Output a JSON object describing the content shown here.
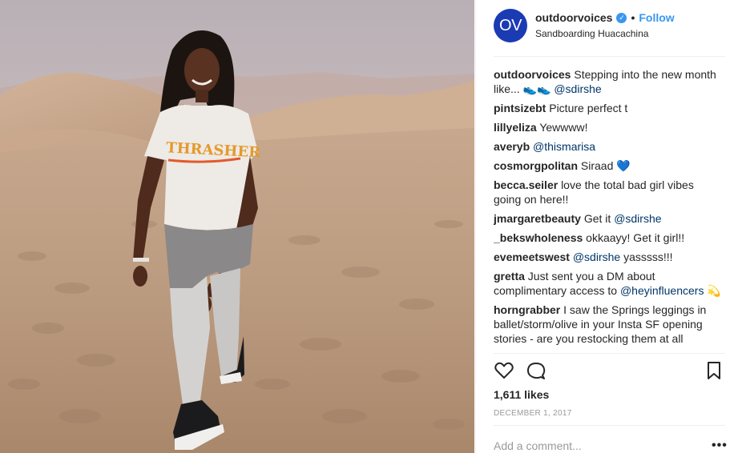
{
  "post": {
    "account": {
      "avatar_text": "OV",
      "username": "outdoorvoices",
      "separator": "•",
      "follow_label": "Follow",
      "location": "Sandboarding Huacachina"
    },
    "comments": [
      {
        "user": "outdoorvoices",
        "text": "Stepping into the new month like...",
        "emoji": "👟👟",
        "mention": "@sdirshe",
        "trailing": ""
      },
      {
        "user": "pintsizebt",
        "text": "Picture perfect",
        "emoji": "",
        "mention": "",
        "trailing": "t"
      },
      {
        "user": "lillyeliza",
        "text": "Yewwww!",
        "emoji": "",
        "mention": "",
        "trailing": ""
      },
      {
        "user": "averyb",
        "text": "",
        "emoji": "",
        "mention": "@thismarisa",
        "trailing": ""
      },
      {
        "user": "cosmorgpolitan",
        "text": "Siraad",
        "emoji": "💙",
        "mention": "",
        "trailing": ""
      },
      {
        "user": "becca.seiler",
        "text": "love the total bad girl vibes going on here!!",
        "emoji": "",
        "mention": "",
        "trailing": ""
      },
      {
        "user": "jmargaretbeauty",
        "text": "Get it",
        "emoji": "",
        "mention": "@sdirshe",
        "trailing": ""
      },
      {
        "user": "_bekswholeness",
        "text": "okkaayy! Get it girl!!",
        "emoji": "",
        "mention": "",
        "trailing": ""
      },
      {
        "user": "evemeetswest",
        "text": "",
        "emoji": "",
        "mention": "@sdirshe",
        "trailing": "yasssss!!!"
      },
      {
        "user": "gretta",
        "text": "Just sent you a DM about complimentary access to",
        "emoji": "",
        "mention": "@heyinfluencers",
        "trailing": "💫"
      },
      {
        "user": "horngrabber",
        "text": "I saw the Springs leggings in ballet/storm/olive in your Insta SF opening stories - are you restocking them at all",
        "emoji": "",
        "mention": "",
        "trailing": ""
      }
    ],
    "actions": {
      "like_icon": "heart-icon",
      "comment_icon": "comment-icon",
      "save_icon": "bookmark-icon"
    },
    "likes": "1,611 likes",
    "date": "DECEMBER 1, 2017",
    "add_comment_placeholder": "Add a comment...",
    "more_label": "•••",
    "colors": {
      "link_blue": "#3897f0",
      "mention_blue": "#003569",
      "avatar_bg": "#1a3bb3"
    }
  }
}
